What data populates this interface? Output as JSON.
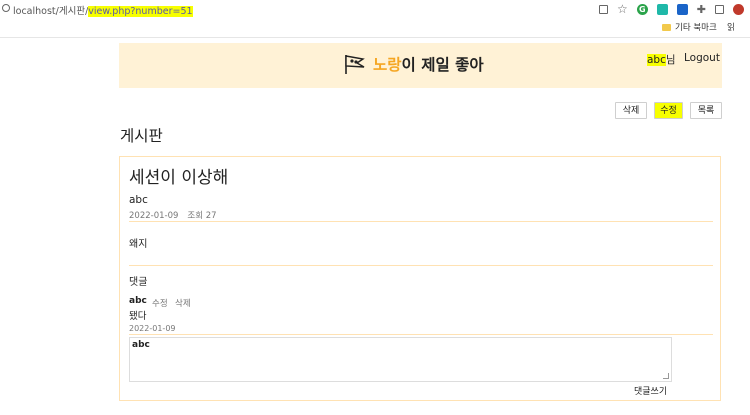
{
  "browser": {
    "url_prefix": "localhost/게시판/",
    "url_highlight": "view.php?number=51",
    "bookmark_folder": "기타 북마크",
    "bookmark_extra": "읽"
  },
  "header": {
    "title_accent": "노랑",
    "title_rest": "이 제일 좋아",
    "user_name": "abc",
    "user_suffix": "님",
    "logout": "Logout"
  },
  "toolbar": {
    "delete_label": "삭제",
    "edit_label": "수정",
    "list_label": "목록"
  },
  "board": {
    "title": "게시판"
  },
  "post": {
    "title": "세션이 이상해",
    "author": "abc",
    "date": "2022-01-09",
    "views_label": "조회 27",
    "body": "왜지"
  },
  "comments": {
    "heading": "댓글",
    "items": [
      {
        "author": "abc",
        "edit": "수정",
        "delete": "삭제",
        "text": "됐다",
        "date": "2022-01-09"
      }
    ],
    "reply_user": "abc",
    "submit_label": "댓글쓰기"
  },
  "colors": {
    "header_bg": "#fff2d6",
    "accent": "#f5a623",
    "highlight": "#f7ff00",
    "border": "#ffe2b3"
  }
}
